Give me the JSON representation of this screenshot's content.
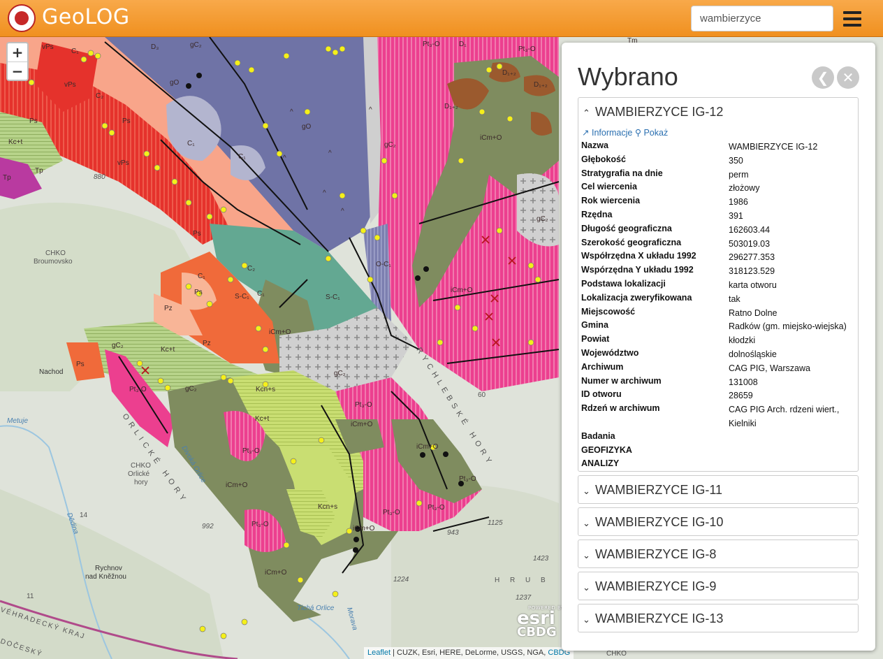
{
  "app": {
    "title": "GeoLOG"
  },
  "search": {
    "value": "wambierzyce"
  },
  "map_controls": {
    "zoom_in": "+",
    "zoom_out": "−"
  },
  "attribution": {
    "leaflet": "Leaflet",
    "sources": " | CUZK, Esri, HERE, DeLorme, USGS, NGA, ",
    "cbdg": "CBDG"
  },
  "esri_badge": {
    "powered": "POWERED BY",
    "brand": "esri",
    "cbdg": "CBDG"
  },
  "map_labels": [
    {
      "text": "vPs"
    },
    {
      "text": "C₁"
    },
    {
      "text": "D₃"
    },
    {
      "text": "gC₂"
    },
    {
      "text": "Pt₃-O"
    },
    {
      "text": "D₁"
    },
    {
      "text": "Pt₃-O"
    },
    {
      "text": "Tm"
    },
    {
      "text": "vPs"
    },
    {
      "text": "C₂"
    },
    {
      "text": "gO"
    },
    {
      "text": "^"
    },
    {
      "text": "^"
    },
    {
      "text": "gO"
    },
    {
      "text": "gC₂"
    },
    {
      "text": "D₁₊₂"
    },
    {
      "text": "D₁₊₂"
    },
    {
      "text": "D₁₊₂"
    },
    {
      "text": "Ps"
    },
    {
      "text": "Ps"
    },
    {
      "text": "C₁"
    },
    {
      "text": "C₁"
    },
    {
      "text": "^"
    },
    {
      "text": "^"
    },
    {
      "text": "iCm+O"
    },
    {
      "text": "Kc+t"
    },
    {
      "text": "vPs"
    },
    {
      "text": "Tp"
    },
    {
      "text": "Tp"
    },
    {
      "text": "880"
    },
    {
      "text": "^"
    },
    {
      "text": "^"
    },
    {
      "text": "gC₂"
    },
    {
      "text": "Ps"
    },
    {
      "text": "CHKO"
    },
    {
      "text": "Broumovsko"
    },
    {
      "text": "C₂"
    },
    {
      "text": "O-C₁"
    },
    {
      "text": "C₁"
    },
    {
      "text": "Ps"
    },
    {
      "text": "S-C₁"
    },
    {
      "text": "C₁"
    },
    {
      "text": "S-C₁"
    },
    {
      "text": "iCm+O"
    },
    {
      "text": "iCm+O"
    },
    {
      "text": "Pz"
    },
    {
      "text": "Pz"
    },
    {
      "text": "gC₂"
    },
    {
      "text": "Kc+t"
    },
    {
      "text": "Nachod"
    },
    {
      "text": "Ps"
    },
    {
      "text": "Pt₃-O"
    },
    {
      "text": "gC₂"
    },
    {
      "text": "Kcn+s"
    },
    {
      "text": "gC₂"
    },
    {
      "text": "Pt₃-O"
    },
    {
      "text": "iCm+O"
    },
    {
      "text": "60"
    },
    {
      "text": "Kc+t"
    },
    {
      "text": "Pt₃-O"
    },
    {
      "text": "iCm+O"
    },
    {
      "text": "CHKO"
    },
    {
      "text": "Orlické"
    },
    {
      "text": "hory"
    },
    {
      "text": "iCm+O"
    },
    {
      "text": "Pt₃-O"
    },
    {
      "text": "Kcn+s"
    },
    {
      "text": "Pt₃-O"
    },
    {
      "text": "Pt₃-O"
    },
    {
      "text": "992"
    },
    {
      "text": "Pt₃-O"
    },
    {
      "text": "iCm+O"
    },
    {
      "text": "1125"
    },
    {
      "text": "943"
    },
    {
      "text": "14"
    },
    {
      "text": "Rychnov"
    },
    {
      "text": "nad Kněžnou"
    },
    {
      "text": "iCm+O"
    },
    {
      "text": "1224"
    },
    {
      "text": "1423"
    },
    {
      "text": "1237"
    },
    {
      "text": "11"
    },
    {
      "text": "ORLICKÉ HORY"
    },
    {
      "text": "RYCHLEBSKÉ HORY"
    },
    {
      "text": "Metuje"
    },
    {
      "text": "Dědina"
    },
    {
      "text": "Divoká Orlice"
    },
    {
      "text": "Tichá Orlice"
    },
    {
      "text": "Morava"
    },
    {
      "text": "VÉHRADECKÝ KRAJ"
    },
    {
      "text": "DOČESKÝ"
    },
    {
      "text": "CHKO"
    },
    {
      "text": "H R U B"
    }
  ],
  "panel": {
    "title": "Wybrano",
    "back_icon": "arrow-left-circle-icon",
    "close_icon": "close-circle-icon",
    "expanded": {
      "header": "WAMBIERZYCE IG-12",
      "info_link": "Informacje",
      "show_link": "Pokaż",
      "rows": [
        {
          "key": "Nazwa",
          "value": "WAMBIERZYCE IG-12"
        },
        {
          "key": "Głębokość",
          "value": "350"
        },
        {
          "key": "Stratygrafia na dnie",
          "value": "perm"
        },
        {
          "key": "Cel wiercenia",
          "value": "złożowy"
        },
        {
          "key": "Rok wiercenia",
          "value": "1986"
        },
        {
          "key": "Rzędna",
          "value": "391"
        },
        {
          "key": "Długość geograficzna",
          "value": "162603.44"
        },
        {
          "key": "Szerokość geograficzna",
          "value": "503019.03"
        },
        {
          "key": "Współrzędna X układu 1992",
          "value": "296277.353"
        },
        {
          "key": "Wspórzędna Y układu 1992",
          "value": "318123.529"
        },
        {
          "key": "Podstawa lokalizacji",
          "value": "karta otworu"
        },
        {
          "key": "Lokalizacja zweryfikowana",
          "value": "tak"
        },
        {
          "key": "Miejscowość",
          "value": "Ratno Dolne"
        },
        {
          "key": "Gmina",
          "value": "Radków (gm. miejsko-wiejska)"
        },
        {
          "key": "Powiat",
          "value": "kłodzki"
        },
        {
          "key": "Województwo",
          "value": "dolnośląskie"
        },
        {
          "key": "Archiwum",
          "value": "CAG PIG, Warszawa"
        },
        {
          "key": "Numer w archiwum",
          "value": "131008"
        },
        {
          "key": "ID otworu",
          "value": "28659"
        },
        {
          "key": "Rdzeń w archiwum",
          "value": "CAG PIG Arch. rdzeni wiert., Kielniki"
        },
        {
          "key": "Badania",
          "value": ""
        },
        {
          "key": "GEOFIZYKA",
          "value": ""
        },
        {
          "key": "ANALIZY",
          "value": ""
        }
      ]
    },
    "collapsed": [
      "WAMBIERZYCE IG-11",
      "WAMBIERZYCE IG-10",
      "WAMBIERZYCE IG-8",
      "WAMBIERZYCE IG-9",
      "WAMBIERZYCE IG-13"
    ]
  },
  "colors": {
    "header": "#f39a2c",
    "pink": "#ec3f8f",
    "slate": "#6f73a6",
    "olive": "#7f8c5f",
    "teal": "#63a892",
    "lime": "#c9de72",
    "orange": "#f06a3a",
    "red": "#e5322c",
    "gray": "#c8c8c8",
    "marker": "#f5f01a"
  }
}
